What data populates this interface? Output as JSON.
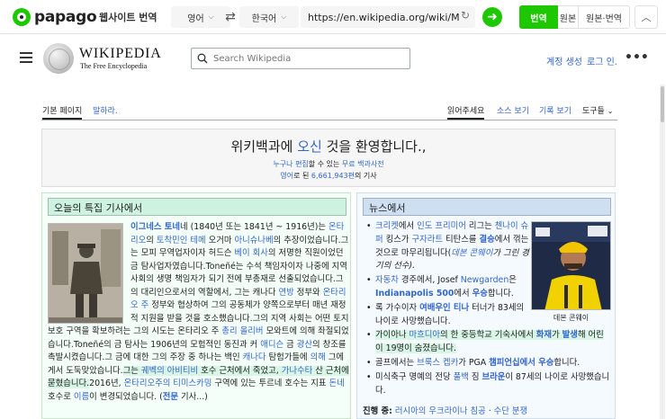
{
  "papago": {
    "logo": "papago",
    "title": "웹사이트 번역",
    "source_lang": "영어",
    "target_lang": "한국어",
    "url": "https://en.wikipedia.org/wiki/Main_Page",
    "buttons": {
      "translated": "번역",
      "original": "원본",
      "both": "원본·번역"
    },
    "accent": "#1ec800"
  },
  "wiki": {
    "wordmark": "WIKIPEDIA",
    "tagline": "The Free Encyclopedia",
    "search_placeholder": "Search Wikipedia",
    "create_account": "계정 생성",
    "login": "로그 인.",
    "more": "•••",
    "tabs": {
      "main": "기본 페이지",
      "talk": "말하라.",
      "read": "읽어주세요",
      "view_source": "소스 보기",
      "history": "기록 보기",
      "tools": "도구들"
    },
    "welcome": {
      "title_pre": "위키백과에 ",
      "title_link": "오신",
      "title_post": " 것을 환영합니다.,",
      "line1_a": "누구나",
      "line1_b": " ",
      "line1_c": "편집",
      "line1_d": "할 수 있는 ",
      "line1_e": "무료 백과사전",
      "line2_a": "영어",
      "line2_b": "로 된 ",
      "line2_c": "6,661,943편",
      "line2_d": "의 기사"
    },
    "featured": {
      "heading": "오늘의 특집 기사에서",
      "p1_link1": "이그네스 토네",
      "p1_t1": "네 (1840년 또는 1841년 ~ 1916년)는 ",
      "p1_link2": "온타리오",
      "p1_t2": "의 ",
      "p1_link3": "토착민인",
      "p1_t3": " ",
      "p1_link4": "테메",
      "p1_t4": " 오거마 ",
      "p1_link5": "아니슈나베",
      "p1_t5": "의 추장이었습니다.그는 모피 무역업자이자 허드슨 ",
      "p1_link6": "베이 회사",
      "p1_t6": "의 저명한 직원이었던 금 탐사업자였습니다.Toneñé는 수석 책임자이자 나중에 지역 사회의 생명 책임자가 되기 전에 부총재로 선출되었습니다.그의 대리인으로서의 역할에서, 그는 캐나다 ",
      "p1_link7": "연방",
      "p1_t7": " 정부와 ",
      "p1_link8": "온타리오 주",
      "p1_t8": " 정부와 협상하여 그의 공동체가 양쪽으로부터 매년 재정적 지원을 받을 것을 호소했습니다.그의 지역 사회는 어떤 토지 보호 구역을 확보하려는 그의 시도는 온타리오 주 ",
      "p1_link9": "총리 올리버",
      "p1_t9": " 모와트에 의해 좌절되었습니다.Toneñé의 금 탐사는 1906년의 모험적인 동진과 커 ",
      "p1_link10": "애디슨",
      "p1_t10": " 금 ",
      "p1_link11": "광산",
      "p1_t11": "의 창조를 촉발시켰습니다.그 금에 대한 그의 주장 중 하나는 백인 ",
      "p1_link12": "캐나다",
      "p1_t12": " 탐험가들에 ",
      "p1_link13": "의해",
      "p1_t13": " 그에게서 도둑맞았습니다.",
      "p1_hl1": "그는 ",
      "p1_link14": "궤벡의 아비티비",
      "p1_hl2": " 호수 근처에서 죽었고, ",
      "p1_link15": "가나수타",
      "p1_hl3": " 산 근처에 묻혔습니다.",
      "p1_t14": "2016년, ",
      "p1_link16": "온타리오주의 티미스카밍",
      "p1_t15": " 구역에 있는 투르네 호수는 지표 ",
      "p1_link17": "돈네",
      "p1_t16": " 호수로 ",
      "p1_link18": "이름",
      "p1_t17": "이 변경되었습니다. (",
      "p1_link19": "전문",
      "p1_t18": " 기사...)"
    },
    "news": {
      "heading": "뉴스에서",
      "caption": "데본 콘웨이",
      "items": [
        {
          "a": "크리켓",
          "b": "에서 ",
          "c": "인도 프리미어",
          "d": " 리그는 ",
          "e": "첸나이 슈퍼",
          "f": " 킹스가 ",
          "g": "구자라트",
          "h": " 티탄스를 ",
          "i": "결승",
          "j": "에서 꺾는 것으로 마무리됩니다(",
          "k": "데본 콘웨이",
          "l": "가 그린 경기의 선수)."
        },
        {
          "a": "자동차",
          "b": " 경주에서, Josef ",
          "c": "Newgarden",
          "d": "은 ",
          "e": "Indianapolis 500",
          "f": "에서 ",
          "g": "우승",
          "h": "합니다."
        },
        {
          "a": "록 가수이자 ",
          "b": "여배우인 티나",
          "c": " 터너가 83세의 나이로 사망했습니다."
        },
        {
          "a": "가이아나 ",
          "b": "마흐디아",
          "c": "의 한 중등학교 기숙사에서 ",
          "d": "화재",
          "e": "가 ",
          "f": "발생",
          "g": "해 어린이 19명이 숨졌습니다."
        },
        {
          "a": "골프에서는 ",
          "b": "브룩스 켑카",
          "c": "가 PGA ",
          "d": "챔피언십에서 우승",
          "e": "합니다."
        },
        {
          "a": "미식축구 명예의 전당 ",
          "b": "풀백",
          "c": " 짐 ",
          "d": "브라운",
          "e": "이 87세의 나이로 사망했습니다."
        }
      ],
      "ongoing_label": "진행 중:",
      "ongoing_a": "러시아의 우크라이나 침공",
      "ongoing_b": " · ",
      "ongoing_c": "수단 분쟁"
    }
  },
  "colors": {
    "link": "#3366cc",
    "featured_bg": "#f5fffa",
    "featured_head": "#cef2e0",
    "news_bg": "#f5faff",
    "news_head": "#cedff2"
  }
}
